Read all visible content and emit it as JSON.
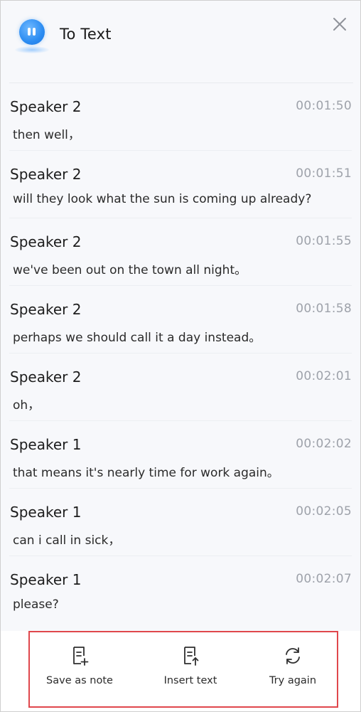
{
  "header": {
    "title": "To Text"
  },
  "entries": [
    {
      "speaker": "Speaker 2",
      "time": "00:01:50",
      "text": "then well，"
    },
    {
      "speaker": "Speaker 2",
      "time": "00:01:51",
      "text": "will they look what the sun is coming up already?"
    },
    {
      "speaker": "Speaker 2",
      "time": "00:01:55",
      "text": "we've been out on the town all night。"
    },
    {
      "speaker": "Speaker 2",
      "time": "00:01:58",
      "text": "perhaps we should call it a day instead。"
    },
    {
      "speaker": "Speaker 2",
      "time": "00:02:01",
      "text": "oh，"
    },
    {
      "speaker": "Speaker 1",
      "time": "00:02:02",
      "text": "that means it's nearly time for work again。"
    },
    {
      "speaker": "Speaker 1",
      "time": "00:02:05",
      "text": "can i call in sick，"
    },
    {
      "speaker": "Speaker 1",
      "time": "00:02:07",
      "text": "please?"
    }
  ],
  "toolbar": {
    "save_label": "Save as note",
    "insert_label": "Insert text",
    "retry_label": "Try again"
  },
  "colors": {
    "accent": "#2b8cf2",
    "highlight_outline": "#e0474c",
    "timestamp": "#9ea2aa"
  },
  "icons": {
    "app": "sound-wave-icon",
    "close": "close-icon",
    "save": "note-add-icon",
    "insert": "document-insert-icon",
    "retry": "refresh-icon"
  }
}
